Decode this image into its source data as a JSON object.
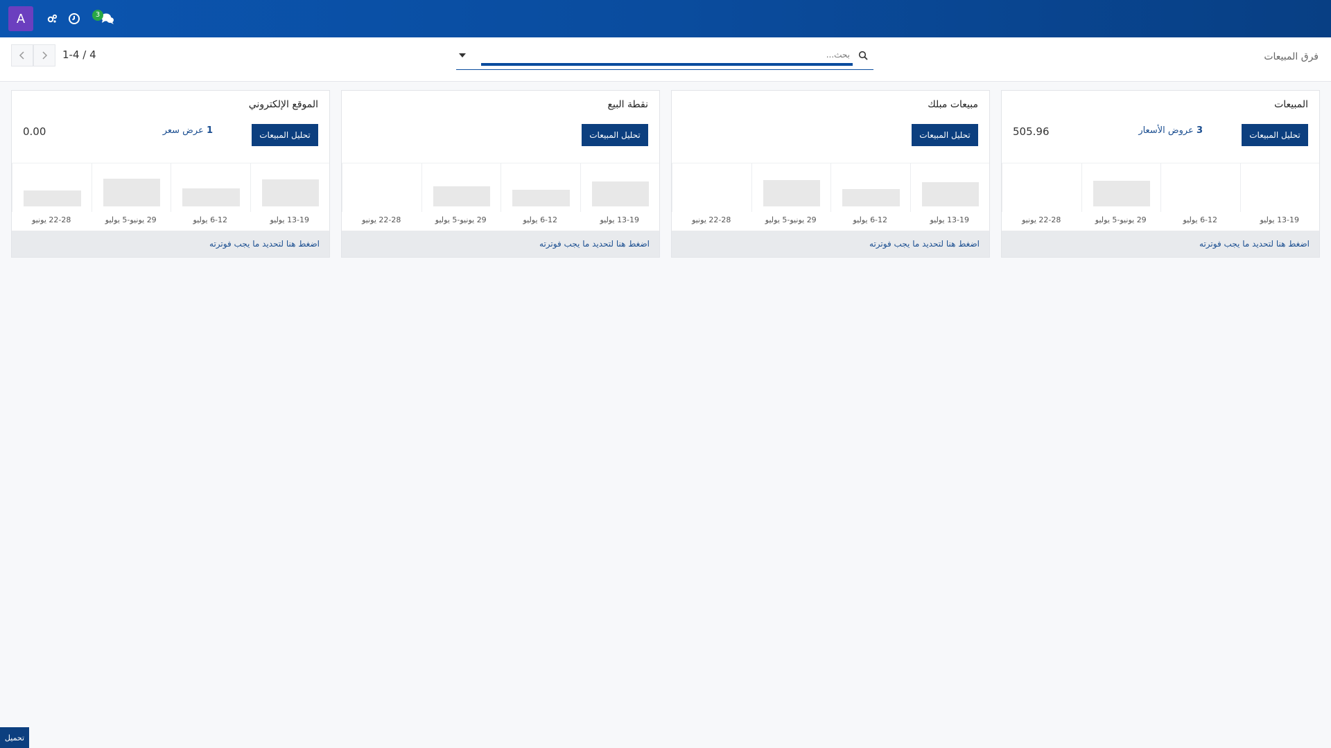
{
  "topbar": {
    "avatar_letter": "A",
    "badge_count": "3",
    "icons": [
      "settings-icon",
      "clock-icon",
      "chat-icon"
    ]
  },
  "control": {
    "breadcrumb": "فرق المبيعات",
    "search_placeholder": "بحث...",
    "pager_value": "1-4 / 4"
  },
  "cards": [
    {
      "title": "المبيعات",
      "button": "تحليل المبيعات",
      "link_count": "3",
      "link_text": "عروض الأسعار",
      "amount": "505.96",
      "highlight_index": 1,
      "bar_levels": [
        0.0,
        0.0,
        0.8,
        0.0
      ],
      "ticks": [
        "13-19 يوليو",
        "6-12 يوليو",
        "29 يونيو-5 يوليو",
        "22-28 يونيو"
      ],
      "footer": "اضغط هنا لتحديد ما يجب فوترته"
    },
    {
      "title": "مبيعات مبلك",
      "button": "تحليل المبيعات",
      "link_count": "",
      "link_text": "",
      "amount": "",
      "highlight_index": -1,
      "bar_levels": [
        0.75,
        0.55,
        0.82,
        0.0
      ],
      "ticks": [
        "13-19 يوليو",
        "6-12 يوليو",
        "29 يونيو-5 يوليو",
        "22-28 يونيو"
      ],
      "footer": "اضغط هنا لتحديد ما يجب فوترته"
    },
    {
      "title": "نقطة البيع",
      "button": "تحليل المبيعات",
      "link_count": "",
      "link_text": "",
      "amount": "",
      "highlight_index": -1,
      "bar_levels": [
        0.78,
        0.52,
        0.62,
        0.0
      ],
      "ticks": [
        "13-19 يوليو",
        "6-12 يوليو",
        "29 يونيو-5 يوليو",
        "22-28 يونيو"
      ],
      "footer": "اضغط هنا لتحديد ما يجب فوترته"
    },
    {
      "title": "الموقع الإلكتروني",
      "button": "تحليل المبيعات",
      "link_count": "1",
      "link_text": "عرض سعر",
      "amount": "0.00",
      "highlight_index": -1,
      "bar_levels": [
        0.85,
        0.56,
        0.88,
        0.5
      ],
      "ticks": [
        "13-19 يوليو",
        "6-12 يوليو",
        "29 يونيو-5 يوليو",
        "22-28 يونيو"
      ],
      "footer": "اضغط هنا لتحديد ما يجب فوترته"
    }
  ],
  "bottom_tab": "تحميل"
}
